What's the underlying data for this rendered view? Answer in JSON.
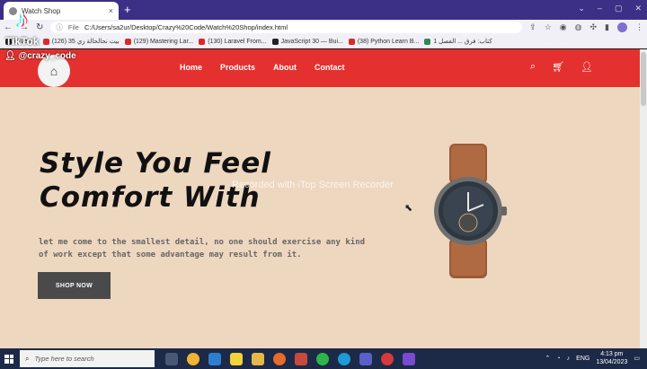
{
  "browser": {
    "tab_title": "Watch Shop",
    "tab_close": "×",
    "new_tab": "+",
    "url_scheme": "File",
    "url": "C:/Users/sa2ur/Desktop/Crazy%20Code/Watch%20Shop/index.html",
    "window_controls": [
      "⌄",
      "–",
      "▢",
      "✕"
    ],
    "bookmarks": [
      {
        "label": "e-Venj...",
        "kind": "dark"
      },
      {
        "label": "(126) بيت نحالحالة زي 35",
        "kind": "red"
      },
      {
        "label": "(129) Mastering Lar...",
        "kind": "red"
      },
      {
        "label": "(130) Laravel From...",
        "kind": "red"
      },
      {
        "label": "JavaScript 30 — Bui...",
        "kind": "dark"
      },
      {
        "label": "(38) Python Learn B...",
        "kind": "red"
      },
      {
        "label": "كتاب: فرق ... الفصل 1",
        "kind": "green"
      }
    ]
  },
  "tiktok": {
    "icon": "♪",
    "label": "TikTok",
    "username": "@crazy_code"
  },
  "site": {
    "logo_icon": "⌂",
    "nav": [
      "Home",
      "Products",
      "About",
      "Contact"
    ],
    "hero": {
      "title_line1": "Style You Feel",
      "title_line2": "Comfort With",
      "description": "let me come to the smallest detail, no one should exercise any kind of work except that some advantage may result from it.",
      "cta": "SHOP NOW"
    }
  },
  "overlay": {
    "watermark": "Recorded with iTop Screen Recorder"
  },
  "taskbar": {
    "search_placeholder": "Type here to search",
    "tray_lang": "ENG",
    "time": "4:13 pm",
    "date": "13/04/2023"
  },
  "colors": {
    "header_red": "#e4312f",
    "page_bg": "#eed7bf",
    "button_dark": "#4a4a4a",
    "tab_strip": "#3c2f86"
  }
}
